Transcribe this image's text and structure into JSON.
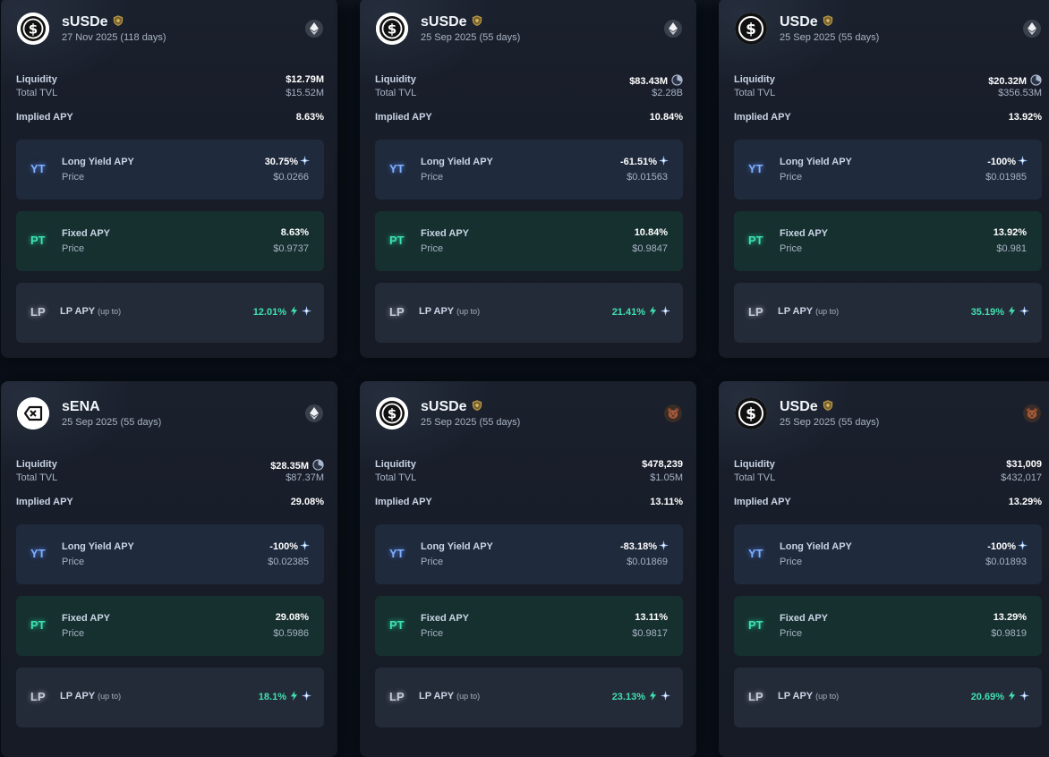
{
  "cards": [
    {
      "name": "sUSDe",
      "date": "27 Nov 2025 (118 days)",
      "chain": "ethereum-icon",
      "liquidity_label": "Liquidity",
      "liquidity": "$12.79M",
      "liquidity_pie": false,
      "tvl_label": "Total TVL",
      "tvl": "$15.52M",
      "implied_label": "Implied APY",
      "implied": "8.63%",
      "yt": {
        "tag": "YT",
        "label": "Long Yield APY",
        "value": "30.75%",
        "price_label": "Price",
        "price": "$0.0266"
      },
      "pt": {
        "tag": "PT",
        "label": "Fixed APY",
        "value": "8.63%",
        "price_label": "Price",
        "price": "$0.9737"
      },
      "lp": {
        "tag": "LP",
        "label": "LP APY",
        "upto": "(up to)",
        "value": "12.01%"
      }
    },
    {
      "name": "sUSDe",
      "date": "25 Sep 2025 (55 days)",
      "chain": "ethereum-icon",
      "liquidity_label": "Liquidity",
      "liquidity": "$83.43M",
      "liquidity_pie": true,
      "tvl_label": "Total TVL",
      "tvl": "$2.28B",
      "implied_label": "Implied APY",
      "implied": "10.84%",
      "yt": {
        "tag": "YT",
        "label": "Long Yield APY",
        "value": "-61.51%",
        "price_label": "Price",
        "price": "$0.01563"
      },
      "pt": {
        "tag": "PT",
        "label": "Fixed APY",
        "value": "10.84%",
        "price_label": "Price",
        "price": "$0.9847"
      },
      "lp": {
        "tag": "LP",
        "label": "LP APY",
        "upto": "(up to)",
        "value": "21.41%"
      }
    },
    {
      "name": "USDe",
      "date": "25 Sep 2025 (55 days)",
      "chain": "ethereum-icon",
      "liquidity_label": "Liquidity",
      "liquidity": "$20.32M",
      "liquidity_pie": true,
      "tvl_label": "Total TVL",
      "tvl": "$356.53M",
      "implied_label": "Implied APY",
      "implied": "13.92%",
      "yt": {
        "tag": "YT",
        "label": "Long Yield APY",
        "value": "-100%",
        "price_label": "Price",
        "price": "$0.01985"
      },
      "pt": {
        "tag": "PT",
        "label": "Fixed APY",
        "value": "13.92%",
        "price_label": "Price",
        "price": "$0.981"
      },
      "lp": {
        "tag": "LP",
        "label": "LP APY",
        "upto": "(up to)",
        "value": "35.19%"
      }
    },
    {
      "name": "sENA",
      "date": "25 Sep 2025 (55 days)",
      "chain": "ethereum-icon",
      "liquidity_label": "Liquidity",
      "liquidity": "$28.35M",
      "liquidity_pie": true,
      "tvl_label": "Total TVL",
      "tvl": "$87.37M",
      "implied_label": "Implied APY",
      "implied": "29.08%",
      "yt": {
        "tag": "YT",
        "label": "Long Yield APY",
        "value": "-100%",
        "price_label": "Price",
        "price": "$0.02385"
      },
      "pt": {
        "tag": "PT",
        "label": "Fixed APY",
        "value": "29.08%",
        "price_label": "Price",
        "price": "$0.5986"
      },
      "lp": {
        "tag": "LP",
        "label": "LP APY",
        "upto": "(up to)",
        "value": "18.1%"
      }
    },
    {
      "name": "sUSDe",
      "date": "25 Sep 2025 (55 days)",
      "chain": "berachain-icon",
      "liquidity_label": "Liquidity",
      "liquidity": "$478,239",
      "liquidity_pie": false,
      "tvl_label": "Total TVL",
      "tvl": "$1.05M",
      "implied_label": "Implied APY",
      "implied": "13.11%",
      "yt": {
        "tag": "YT",
        "label": "Long Yield APY",
        "value": "-83.18%",
        "price_label": "Price",
        "price": "$0.01869"
      },
      "pt": {
        "tag": "PT",
        "label": "Fixed APY",
        "value": "13.11%",
        "price_label": "Price",
        "price": "$0.9817"
      },
      "lp": {
        "tag": "LP",
        "label": "LP APY",
        "upto": "(up to)",
        "value": "23.13%"
      }
    },
    {
      "name": "USDe",
      "date": "25 Sep 2025 (55 days)",
      "chain": "berachain-icon",
      "liquidity_label": "Liquidity",
      "liquidity": "$31,009",
      "liquidity_pie": false,
      "tvl_label": "Total TVL",
      "tvl": "$432,017",
      "implied_label": "Implied APY",
      "implied": "13.29%",
      "yt": {
        "tag": "YT",
        "label": "Long Yield APY",
        "value": "-100%",
        "price_label": "Price",
        "price": "$0.01893"
      },
      "pt": {
        "tag": "PT",
        "label": "Fixed APY",
        "value": "13.29%",
        "price_label": "Price",
        "price": "$0.9819"
      },
      "lp": {
        "tag": "LP",
        "label": "LP APY",
        "upto": "(up to)",
        "value": "20.69%"
      }
    }
  ],
  "colors": {
    "page_bg": "#0a0f18",
    "card_bg": "#1a202c",
    "yt_box": "#1f2a3c",
    "pt_box": "#16302f",
    "lp_box": "#242b38",
    "yt_accent": "#7fb0ff",
    "pt_accent": "#3fe0b0",
    "lp_apy_text": "#3fe0b0",
    "shield_badge": "#c9a24a"
  }
}
